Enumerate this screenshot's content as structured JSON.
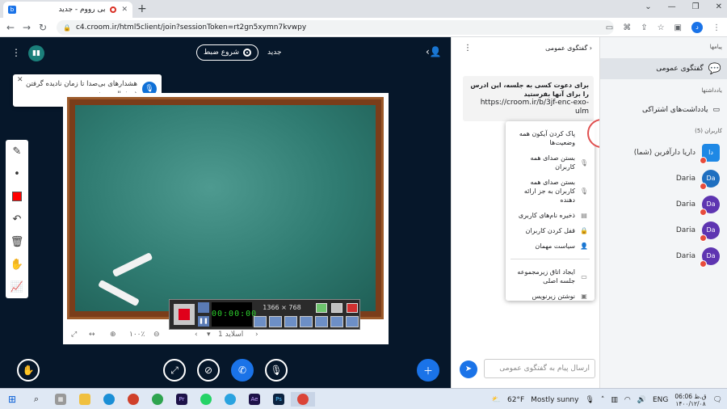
{
  "browser": {
    "tab_title": "بی رووم - جدید",
    "url": "c4.croom.ir/html5client/join?sessionToken=rt2gn5xymn7kvwpy",
    "profile_initial": "د"
  },
  "topbar": {
    "record_label": "شروع ضبط",
    "new_label": "جدید"
  },
  "toast": {
    "message": "هشدارهای بی‌صدا تا زمان نادیده گرفتن غیرفعال می‌شوند"
  },
  "slide": {
    "zoom": "۱۰۰٪",
    "slide_label": "اسلاید 1"
  },
  "recorder": {
    "timer": "00:00:00",
    "resolution": "1366 × 768"
  },
  "chat": {
    "title": "گفتگوی عمومی",
    "welcome_text": "برای دعوت کسی به جلسه، این ادرس را برای آنها بفرستید",
    "welcome_link": "https://croom.ir/b/3jf-enc-exo-ulm",
    "input_placeholder": "ارسال پیام به گفتگوی عمومی"
  },
  "menu": {
    "items": [
      "پاک کردن آیکون همه وضعیت‌ها",
      "بستن صدای همه کاربران",
      "بستن صدای همه کاربران به جز ارائه دهنده",
      "ذخیره نام‌های کاربری",
      "قفل کردن کاربران",
      "سیاست مهمان",
      "ایجاد اتاق زیرمجموعه جلسه اصلی",
      "نوشتن زیرنویس"
    ]
  },
  "users_panel": {
    "messages_header": "پیامها",
    "public_chat": "گفتگوی عمومی",
    "notes_header": "یادداشتها",
    "shared_notes": "یادداشت‌های اشتراکی",
    "users_header": "کاربران (5)",
    "users": [
      {
        "name": "داریا دارآفرین (شما)",
        "initials": "دا",
        "color": "#1e88e5"
      },
      {
        "name": "Daria",
        "initials": "Da",
        "color": "#1e6fc0"
      },
      {
        "name": "Daria",
        "initials": "Da",
        "color": "#5e35b1"
      },
      {
        "name": "Daria",
        "initials": "Da",
        "color": "#5e35b1"
      },
      {
        "name": "Daria",
        "initials": "Da",
        "color": "#5e35b1"
      }
    ]
  },
  "taskbar": {
    "temp": "62°F",
    "weather": "Mostly sunny",
    "lang": "ENG",
    "time": "ق.ظ 06:06",
    "date": "۱۴۰۰/۱۲/۰۸"
  },
  "colors": {
    "accent": "#1a73e8",
    "main_bg": "#06172a",
    "highlight_ring": "#e05050"
  }
}
